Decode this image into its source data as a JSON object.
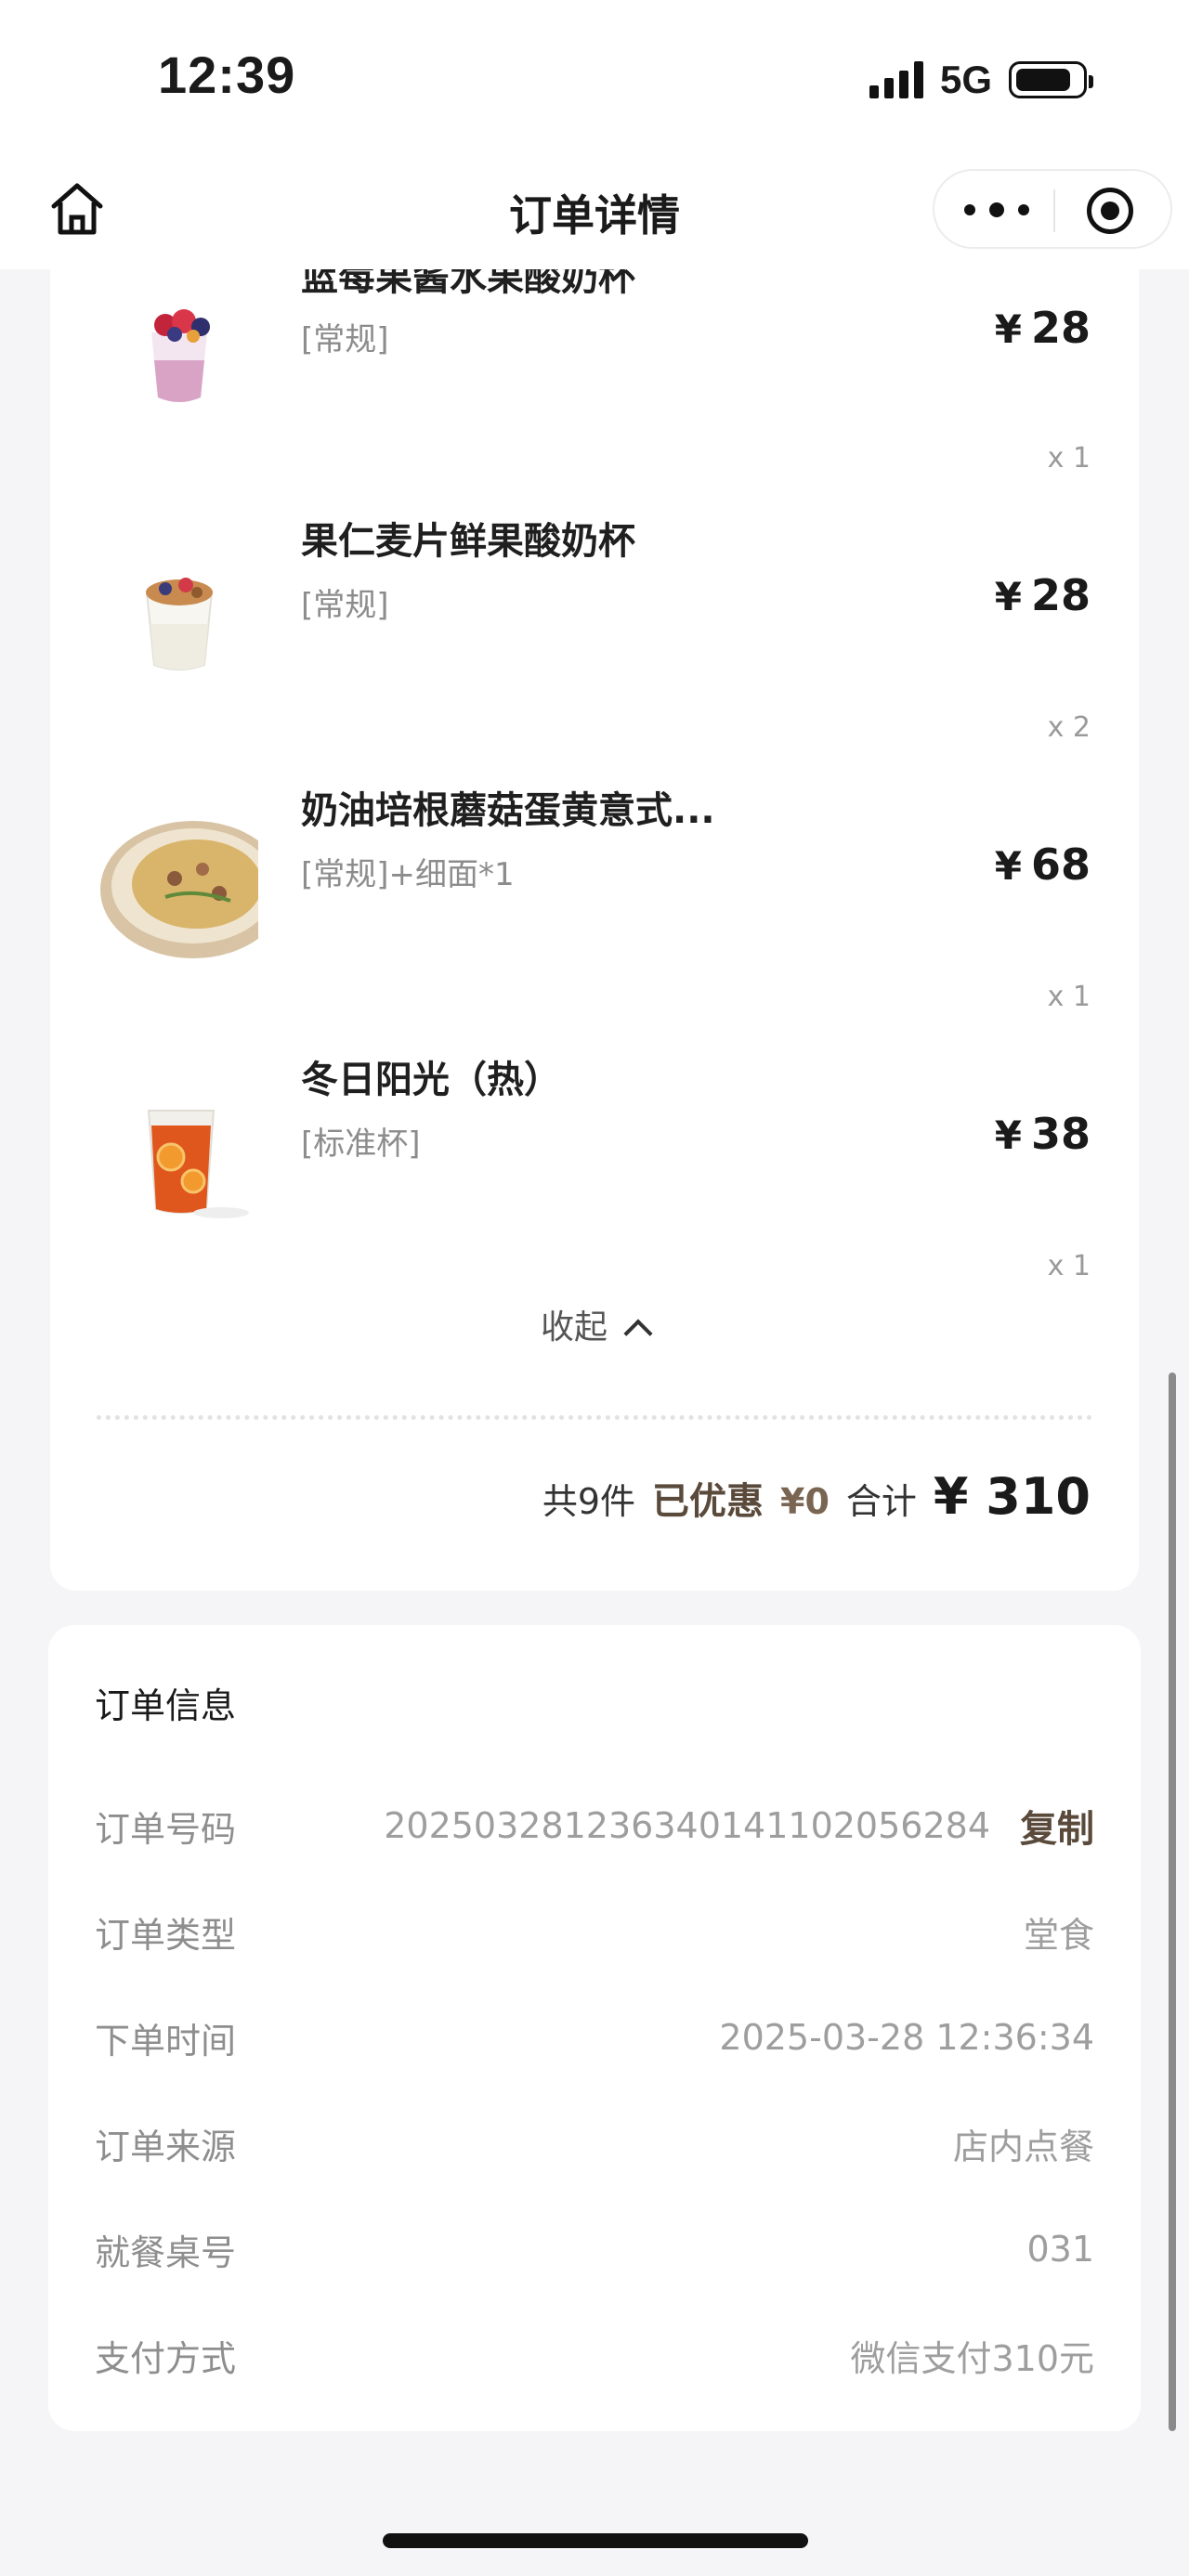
{
  "status": {
    "time": "12:39",
    "network": "5G"
  },
  "nav": {
    "title": "订单详情",
    "home_icon": "home-icon",
    "more_icon": "more-icon",
    "mini_program_icon": "target-icon"
  },
  "items": [
    {
      "name": "蓝莓果酱水果酸奶杯",
      "spec": "[常规]",
      "price": "28",
      "qty": "x 1",
      "thumb": "berry-yogurt"
    },
    {
      "name": "果仁麦片鲜果酸奶杯",
      "spec": "[常规]",
      "price": "28",
      "qty": "x 2",
      "thumb": "granola-yogurt"
    },
    {
      "name": "奶油培根蘑菇蛋黄意式...",
      "spec": "[常规]+细面*1",
      "price": "68",
      "qty": "x 1",
      "thumb": "pasta"
    },
    {
      "name": "冬日阳光（热）",
      "spec": "[标准杯]",
      "price": "38",
      "qty": "x 1",
      "thumb": "tea"
    }
  ],
  "currency": "¥",
  "collapse_label": "收起",
  "summary": {
    "count": "共9件",
    "discount_label": "已优惠",
    "discount_value": "¥0",
    "total_label": "合计",
    "total_value": "¥ 310"
  },
  "order_info": {
    "title": "订单信息",
    "copy_label": "复制",
    "rows": [
      {
        "label": "订单号码",
        "value": "20250328123634014110205628​4"
      },
      {
        "label": "订单类型",
        "value": "堂食"
      },
      {
        "label": "下单时间",
        "value": "2025-03-28 12:36:34"
      },
      {
        "label": "订单来源",
        "value": "店内点餐"
      },
      {
        "label": "就餐桌号",
        "value": "031"
      },
      {
        "label": "支付方式",
        "value": "微信支付310元"
      }
    ]
  }
}
